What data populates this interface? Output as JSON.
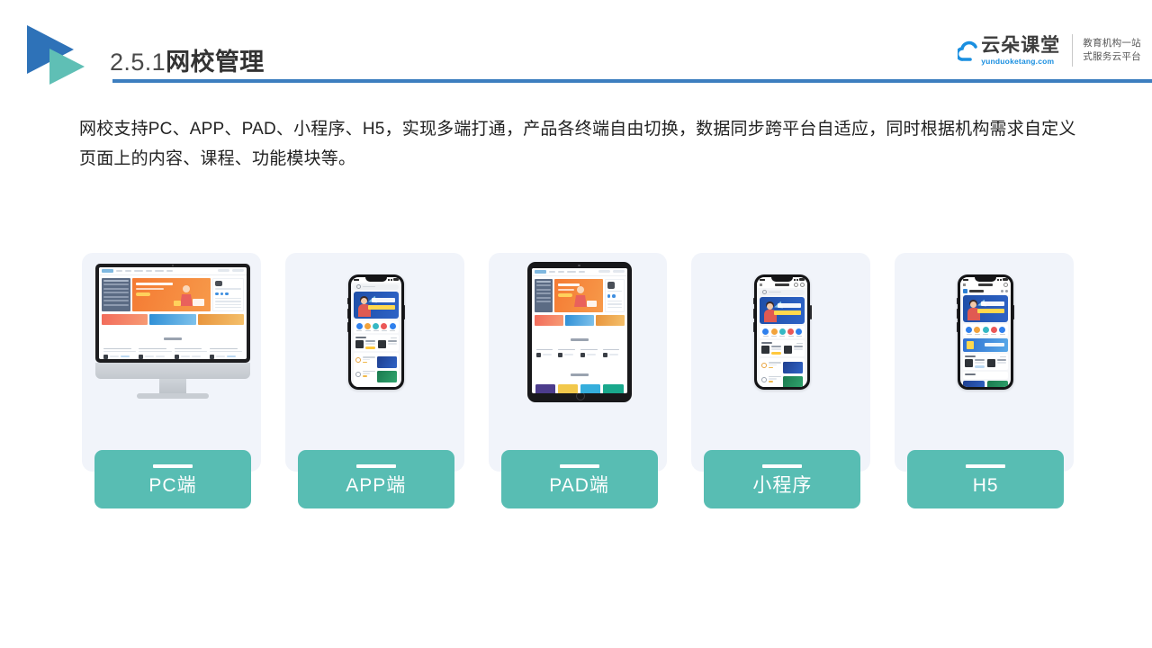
{
  "header": {
    "title_number": "2.5.1",
    "title_text": "网校管理",
    "rule_color": "#3D7EBF",
    "logo_icon": "double-triangle-play-icon",
    "triangle_blue": "#2E72B8",
    "triangle_teal": "#5FBFB5"
  },
  "brand": {
    "cloud_icon": "cloud-icon",
    "name_cn": "云朵课堂",
    "domain": "yunduoketang.com",
    "tagline_line1": "教育机构一站",
    "tagline_line2": "式服务云平台",
    "accent_color": "#1a8fe0"
  },
  "intro": {
    "paragraph": "网校支持PC、APP、PAD、小程序、H5，实现多端打通，产品各终端自由切换，数据同步跨平台自适应，同时根据机构需求自定义页面上的内容、课程、功能模块等。"
  },
  "cards": {
    "label_color": "#58BDB3",
    "card_bg": "#F1F4FA",
    "items": [
      {
        "label": "PC端",
        "device": "desktop-imac",
        "card_name": "device-card-pc"
      },
      {
        "label": "APP端",
        "device": "phone-app",
        "card_name": "device-card-app"
      },
      {
        "label": "PAD端",
        "device": "tablet-ipad",
        "card_name": "device-card-pad"
      },
      {
        "label": "小程序",
        "device": "phone-miniapp",
        "card_name": "device-card-miniprogram"
      },
      {
        "label": "H5",
        "device": "phone-h5",
        "card_name": "device-card-h5"
      }
    ]
  }
}
